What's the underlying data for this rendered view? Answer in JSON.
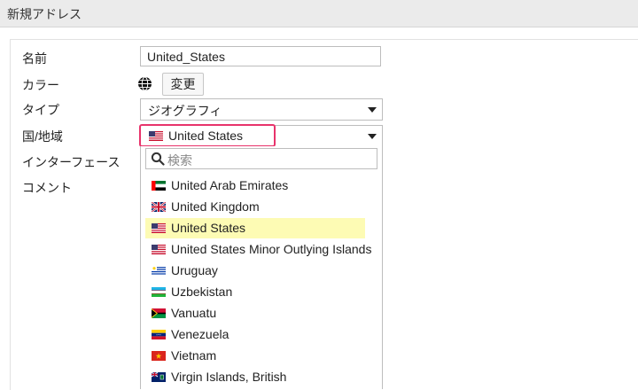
{
  "window": {
    "title": "新規アドレス"
  },
  "form": {
    "name_label": "名前",
    "name_value": "United_States",
    "color_label": "カラー",
    "color_button": "変更",
    "type_label": "タイプ",
    "type_value": "ジオグラフィ",
    "country_label": "国/地域",
    "country_value": "United States",
    "interface_label": "インターフェース",
    "comment_label": "コメント"
  },
  "dropdown": {
    "search_placeholder": "検索",
    "options": [
      {
        "label": "United Arab Emirates",
        "flag": "ae"
      },
      {
        "label": "United Kingdom",
        "flag": "gb"
      },
      {
        "label": "United States",
        "flag": "us",
        "selected": true
      },
      {
        "label": "United States Minor Outlying Islands",
        "flag": "us"
      },
      {
        "label": "Uruguay",
        "flag": "uy"
      },
      {
        "label": "Uzbekistan",
        "flag": "uz"
      },
      {
        "label": "Vanuatu",
        "flag": "vu"
      },
      {
        "label": "Venezuela",
        "flag": "ve"
      },
      {
        "label": "Vietnam",
        "flag": "vn"
      },
      {
        "label": "Virgin Islands, British",
        "flag": "vg"
      }
    ]
  },
  "colors": {
    "highlight_border": "#e8336b",
    "selected_option_bg": "#fdfbb4"
  }
}
